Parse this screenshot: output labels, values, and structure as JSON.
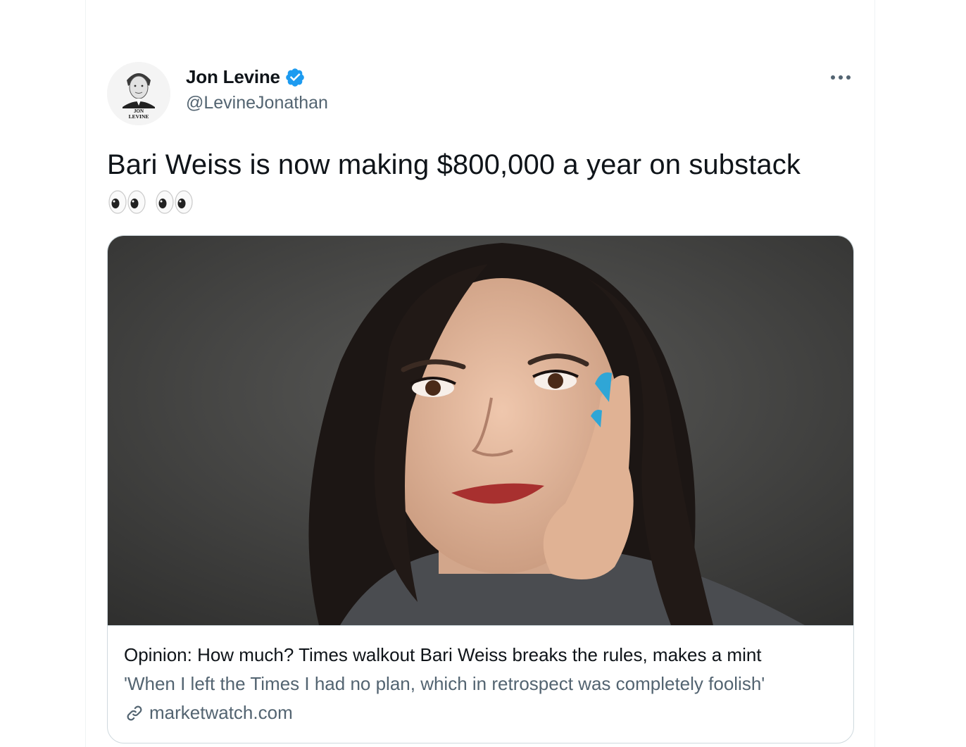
{
  "tweet": {
    "author": {
      "display_name": "Jon Levine",
      "handle": "@LevineJonathan",
      "avatar_caption_line1": "JON",
      "avatar_caption_line2": "LEVINE",
      "verified": true
    },
    "text": "Bari Weiss is now making $800,000 a year on substack",
    "emoji": [
      "eyes-icon",
      "eyes-icon"
    ],
    "more_icon": "more-horizontal-icon"
  },
  "card": {
    "image_alt": "portrait photo",
    "title": "Opinion: How much? Times walkout Bari Weiss breaks the rules, makes a mint",
    "description": "'When I left the Times I had no plan, which in retrospect was completely foolish'",
    "domain": "marketwatch.com",
    "domain_icon": "link-icon"
  },
  "colors": {
    "text_primary": "#0f1419",
    "text_secondary": "#536471",
    "verified_blue": "#1d9bf0",
    "border": "#cfd9de",
    "nail_blue": "#2fa6d6"
  }
}
